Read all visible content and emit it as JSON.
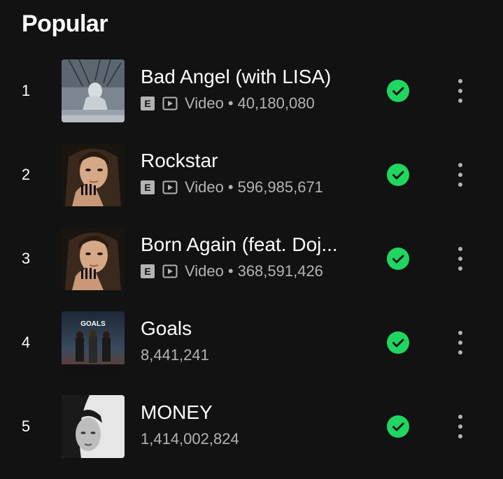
{
  "section": {
    "title": "Popular"
  },
  "tracks": [
    {
      "rank": "1",
      "title": "Bad Angel (with LISA)",
      "explicit": "E",
      "video_label": "Video",
      "separator": "•",
      "plays": "40,180,080",
      "cover_icon": "album-cover-bad-angel"
    },
    {
      "rank": "2",
      "title": "Rockstar",
      "explicit": "E",
      "video_label": "Video",
      "separator": "•",
      "plays": "596,985,671",
      "cover_icon": "album-cover-alter-ego"
    },
    {
      "rank": "3",
      "title": "Born Again (feat. Doj...",
      "explicit": "E",
      "video_label": "Video",
      "separator": "•",
      "plays": "368,591,426",
      "cover_icon": "album-cover-alter-ego"
    },
    {
      "rank": "4",
      "title": "Goals",
      "plays": "8,441,241",
      "cover_icon": "album-cover-goals",
      "cover_text": "GOALS"
    },
    {
      "rank": "5",
      "title": "MONEY",
      "plays": "1,414,002,824",
      "cover_icon": "album-cover-lalisa"
    }
  ],
  "colors": {
    "background": "#121212",
    "accent_green": "#1ed760",
    "secondary_text": "#b3b3b3"
  },
  "icons": {
    "saved": "check-circle-icon",
    "more": "more-vertical-icon",
    "video": "video-play-icon"
  }
}
